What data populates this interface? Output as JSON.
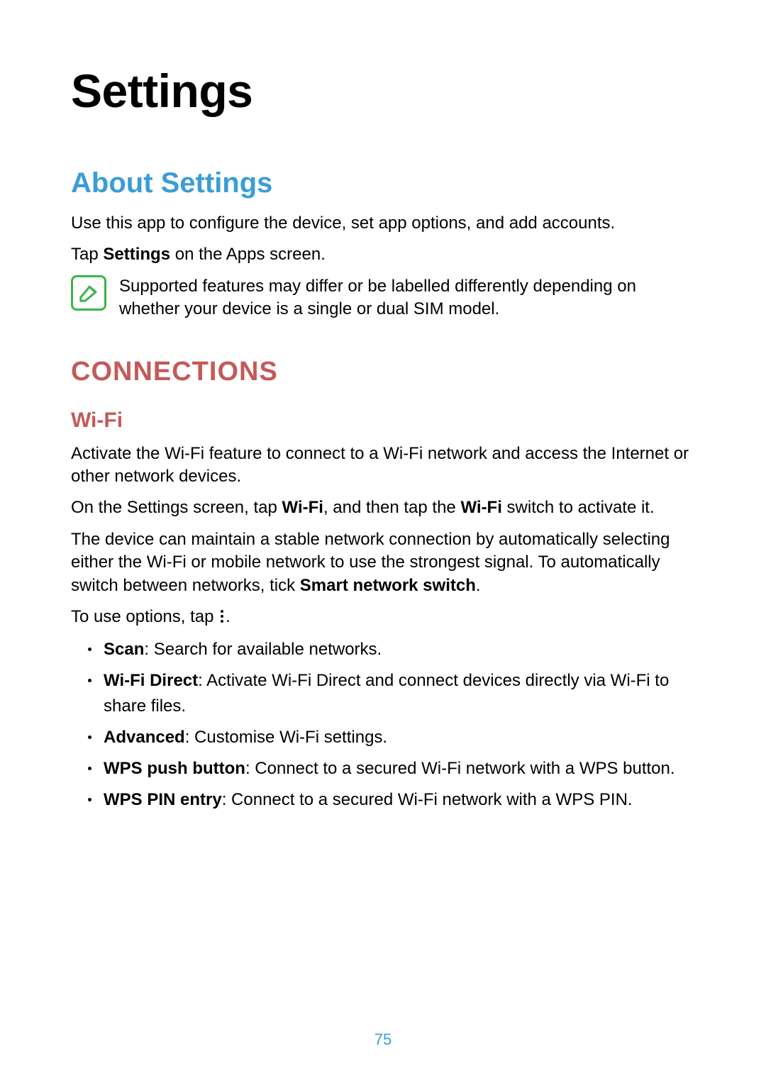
{
  "title": "Settings",
  "about": {
    "heading": "About Settings",
    "para1": "Use this app to configure the device, set app options, and add accounts.",
    "para2_prefix": "Tap ",
    "para2_bold": "Settings",
    "para2_suffix": " on the Apps screen.",
    "note_icon": "note-icon",
    "note_text": "Supported features may differ or be labelled differently depending on whether your device is a single or dual SIM model."
  },
  "connections": {
    "heading": "CONNECTIONS",
    "wifi": {
      "heading": "Wi-Fi",
      "para1": "Activate the Wi-Fi feature to connect to a Wi-Fi network and access the Internet or other network devices.",
      "para2_a": "On the Settings screen, tap ",
      "para2_b_bold": "Wi-Fi",
      "para2_c": ", and then tap the ",
      "para2_d_bold": "Wi-Fi",
      "para2_e": " switch to activate it.",
      "para3_a": "The device can maintain a stable network connection by automatically selecting either the Wi-Fi or mobile network to use the strongest signal. To automatically switch between networks, tick ",
      "para3_b_bold": "Smart network switch",
      "para3_c": ".",
      "para4_a": "To use options, tap ",
      "para4_b_icon": "kebab-icon",
      "para4_c": ".",
      "options": [
        {
          "bold": "Scan",
          "rest": ": Search for available networks."
        },
        {
          "bold": "Wi-Fi Direct",
          "rest": ": Activate Wi-Fi Direct and connect devices directly via Wi-Fi to share files."
        },
        {
          "bold": "Advanced",
          "rest": ": Customise Wi-Fi settings."
        },
        {
          "bold": "WPS push button",
          "rest": ": Connect to a secured Wi-Fi network with a WPS button."
        },
        {
          "bold": "WPS PIN entry",
          "rest": ": Connect to a secured Wi-Fi network with a WPS PIN."
        }
      ]
    }
  },
  "page_number": "75"
}
